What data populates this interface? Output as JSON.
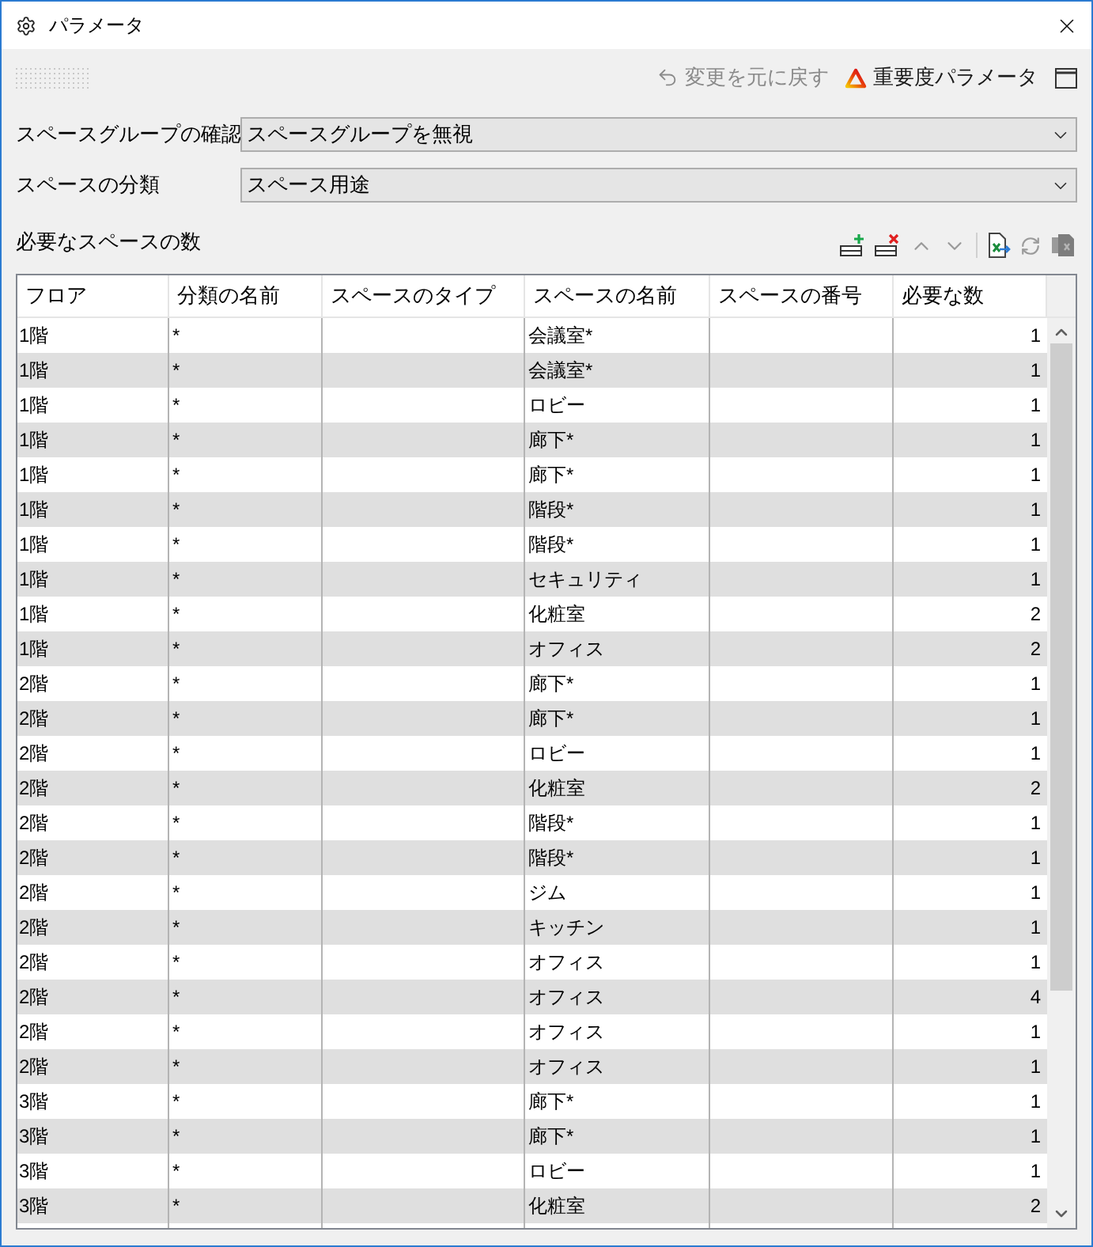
{
  "window": {
    "title": "パラメータ"
  },
  "toolbar": [
    {
      "kind": "undo",
      "label": "変更を元に戻す",
      "disabled": true
    },
    {
      "kind": "priority",
      "label": "重要度パラメータ",
      "disabled": false
    }
  ],
  "fields": [
    {
      "label": "スペースグループの確認",
      "value": "スペースグループを無視"
    },
    {
      "label": "スペースの分類",
      "value": "スペース用途"
    }
  ],
  "table": {
    "title": "必要なスペースの数",
    "columns": [
      "フロア",
      "分類の名前",
      "スペースのタイプ",
      "スペースの名前",
      "スペースの番号",
      "必要な数"
    ],
    "rows": [
      {
        "floor": "1階",
        "category_name": "*",
        "space_name": "会議室*",
        "required_count": "1"
      },
      {
        "floor": "1階",
        "category_name": "*",
        "space_name": "会議室*",
        "required_count": "1"
      },
      {
        "floor": "1階",
        "category_name": "*",
        "space_name": "ロビー",
        "required_count": "1"
      },
      {
        "floor": "1階",
        "category_name": "*",
        "space_name": "廊下*",
        "required_count": "1"
      },
      {
        "floor": "1階",
        "category_name": "*",
        "space_name": "廊下*",
        "required_count": "1"
      },
      {
        "floor": "1階",
        "category_name": "*",
        "space_name": "階段*",
        "required_count": "1"
      },
      {
        "floor": "1階",
        "category_name": "*",
        "space_name": "階段*",
        "required_count": "1"
      },
      {
        "floor": "1階",
        "category_name": "*",
        "space_name": "セキュリティ",
        "required_count": "1"
      },
      {
        "floor": "1階",
        "category_name": "*",
        "space_name": "化粧室",
        "required_count": "2"
      },
      {
        "floor": "1階",
        "category_name": "*",
        "space_name": "オフィス",
        "required_count": "2"
      },
      {
        "floor": "2階",
        "category_name": "*",
        "space_name": "廊下*",
        "required_count": "1"
      },
      {
        "floor": "2階",
        "category_name": "*",
        "space_name": "廊下*",
        "required_count": "1"
      },
      {
        "floor": "2階",
        "category_name": "*",
        "space_name": "ロビー",
        "required_count": "1"
      },
      {
        "floor": "2階",
        "category_name": "*",
        "space_name": "化粧室",
        "required_count": "2"
      },
      {
        "floor": "2階",
        "category_name": "*",
        "space_name": "階段*",
        "required_count": "1"
      },
      {
        "floor": "2階",
        "category_name": "*",
        "space_name": "階段*",
        "required_count": "1"
      },
      {
        "floor": "2階",
        "category_name": "*",
        "space_name": "ジム",
        "required_count": "1"
      },
      {
        "floor": "2階",
        "category_name": "*",
        "space_name": "キッチン",
        "required_count": "1"
      },
      {
        "floor": "2階",
        "category_name": "*",
        "space_name": "オフィス",
        "required_count": "1"
      },
      {
        "floor": "2階",
        "category_name": "*",
        "space_name": "オフィス",
        "required_count": "4"
      },
      {
        "floor": "2階",
        "category_name": "*",
        "space_name": "オフィス",
        "required_count": "1"
      },
      {
        "floor": "2階",
        "category_name": "*",
        "space_name": "オフィス",
        "required_count": "1"
      },
      {
        "floor": "3階",
        "category_name": "*",
        "space_name": "廊下*",
        "required_count": "1"
      },
      {
        "floor": "3階",
        "category_name": "*",
        "space_name": "廊下*",
        "required_count": "1"
      },
      {
        "floor": "3階",
        "category_name": "*",
        "space_name": "ロビー",
        "required_count": "1"
      },
      {
        "floor": "3階",
        "category_name": "*",
        "space_name": "化粧室",
        "required_count": "2"
      }
    ]
  }
}
